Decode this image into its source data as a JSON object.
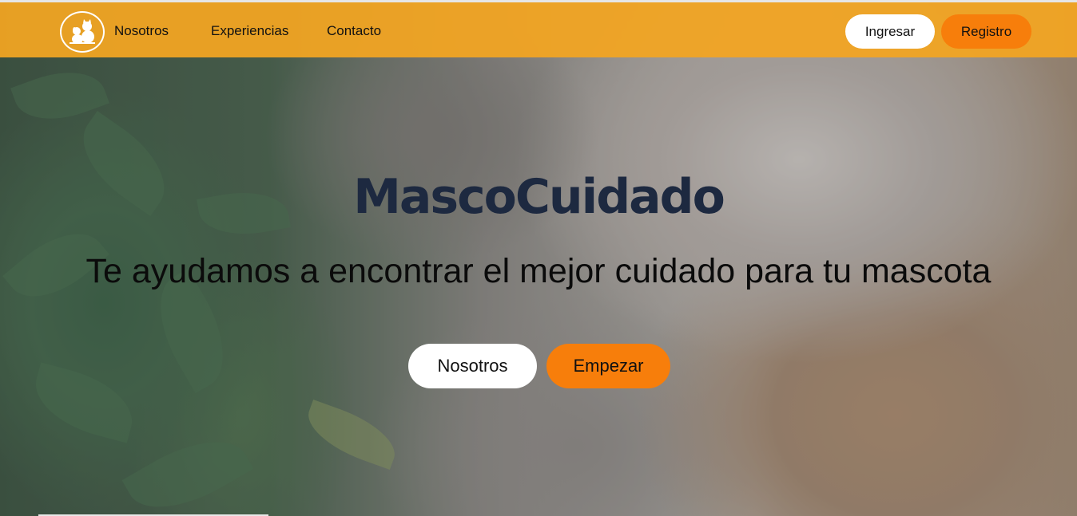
{
  "navbar": {
    "links": [
      "Nosotros",
      "Experiencias",
      "Contacto"
    ],
    "login_label": "Ingresar",
    "register_label": "Registro"
  },
  "hero": {
    "title": "MascoCuidado",
    "subtitle": "Te ayudamos a encontrar el mejor cuidado para tu mascota",
    "primary_button": "Nosotros",
    "secondary_button": "Empezar"
  },
  "icons": {
    "logo": "dog-and-cat-logo-icon"
  },
  "colors": {
    "navbar": "#f2a522",
    "accent_orange": "#f77e0b",
    "title": "#1d2940",
    "white": "#ffffff"
  }
}
